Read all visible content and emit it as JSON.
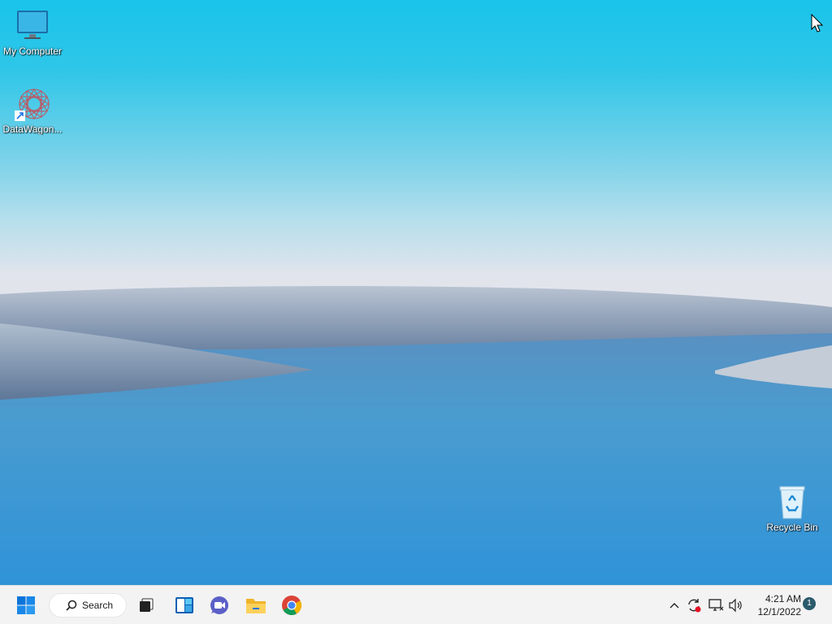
{
  "desktop": {
    "icons": [
      {
        "label": "My Computer",
        "icon": "monitor-icon"
      },
      {
        "label": "DataWagon...",
        "icon": "datawagon-shortcut-icon"
      },
      {
        "label": "Recycle Bin",
        "icon": "recycle-bin-icon"
      }
    ]
  },
  "taskbar": {
    "search_label": "Search",
    "pinned": [
      "start-icon",
      "search-icon",
      "task-view-icon",
      "widgets-icon",
      "chat-icon",
      "file-explorer-icon",
      "chrome-icon"
    ],
    "tray": [
      "chevron-up-icon",
      "sync-icon",
      "network-icon",
      "volume-icon"
    ],
    "clock": {
      "time": "4:21 AM",
      "date": "12/1/2022"
    },
    "notification_count": "1"
  },
  "colors": {
    "sky_top": "#19c4ea",
    "water": "#3a9bd4",
    "taskbar": "#f3f3f3",
    "start_blue": "#0a74d9"
  }
}
